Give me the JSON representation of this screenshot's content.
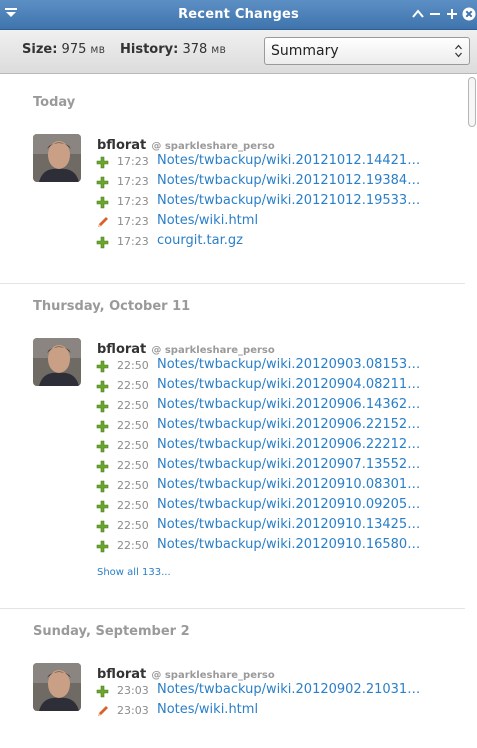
{
  "window": {
    "title": "Recent Changes"
  },
  "info": {
    "size_label": "Size:",
    "size_value": "975",
    "size_unit": "MB",
    "history_label": "History:",
    "history_value": "378",
    "history_unit": "MB",
    "view_select": "Summary"
  },
  "groups": [
    {
      "date": "Today",
      "author": "bflorat",
      "repo": "@ sparkleshare_perso",
      "changes": [
        {
          "type": "added",
          "time": "17:23",
          "path": "Notes/twbackup/wiki.20121012.144216..."
        },
        {
          "type": "added",
          "time": "17:23",
          "path": "Notes/twbackup/wiki.20121012.193840..."
        },
        {
          "type": "added",
          "time": "17:23",
          "path": "Notes/twbackup/wiki.20121012.195331..."
        },
        {
          "type": "edited",
          "time": "17:23",
          "path": "Notes/wiki.html"
        },
        {
          "type": "added",
          "time": "17:23",
          "path": "courgit.tar.gz"
        }
      ]
    },
    {
      "date": "Thursday, October 11",
      "author": "bflorat",
      "repo": "@ sparkleshare_perso",
      "changes": [
        {
          "type": "added",
          "time": "22:50",
          "path": "Notes/twbackup/wiki.20120903.081538..."
        },
        {
          "type": "added",
          "time": "22:50",
          "path": "Notes/twbackup/wiki.20120904.082118..."
        },
        {
          "type": "added",
          "time": "22:50",
          "path": "Notes/twbackup/wiki.20120906.143622..."
        },
        {
          "type": "added",
          "time": "22:50",
          "path": "Notes/twbackup/wiki.20120906.221525..."
        },
        {
          "type": "added",
          "time": "22:50",
          "path": "Notes/twbackup/wiki.20120906.222125..."
        },
        {
          "type": "added",
          "time": "22:50",
          "path": "Notes/twbackup/wiki.20120907.135520..."
        },
        {
          "type": "added",
          "time": "22:50",
          "path": "Notes/twbackup/wiki.20120910.083016..."
        },
        {
          "type": "added",
          "time": "22:50",
          "path": "Notes/twbackup/wiki.20120910.092050..."
        },
        {
          "type": "added",
          "time": "22:50",
          "path": "Notes/twbackup/wiki.20120910.134255..."
        },
        {
          "type": "added",
          "time": "22:50",
          "path": "Notes/twbackup/wiki.20120910.165807..."
        }
      ],
      "show_all": "Show all 133..."
    },
    {
      "date": "Sunday, September 2",
      "author": "bflorat",
      "repo": "@ sparkleshare_perso",
      "changes": [
        {
          "type": "added",
          "time": "23:03",
          "path": "Notes/twbackup/wiki.20120902.210314..."
        },
        {
          "type": "edited",
          "time": "23:03",
          "path": "Notes/wiki.html"
        }
      ]
    }
  ],
  "colors": {
    "titlebar": "#4a80b8",
    "link": "#2a7fc8",
    "heading": "#9a9a9a",
    "added_icon": "#6aa52e",
    "edited_icon": "#d9622b"
  }
}
